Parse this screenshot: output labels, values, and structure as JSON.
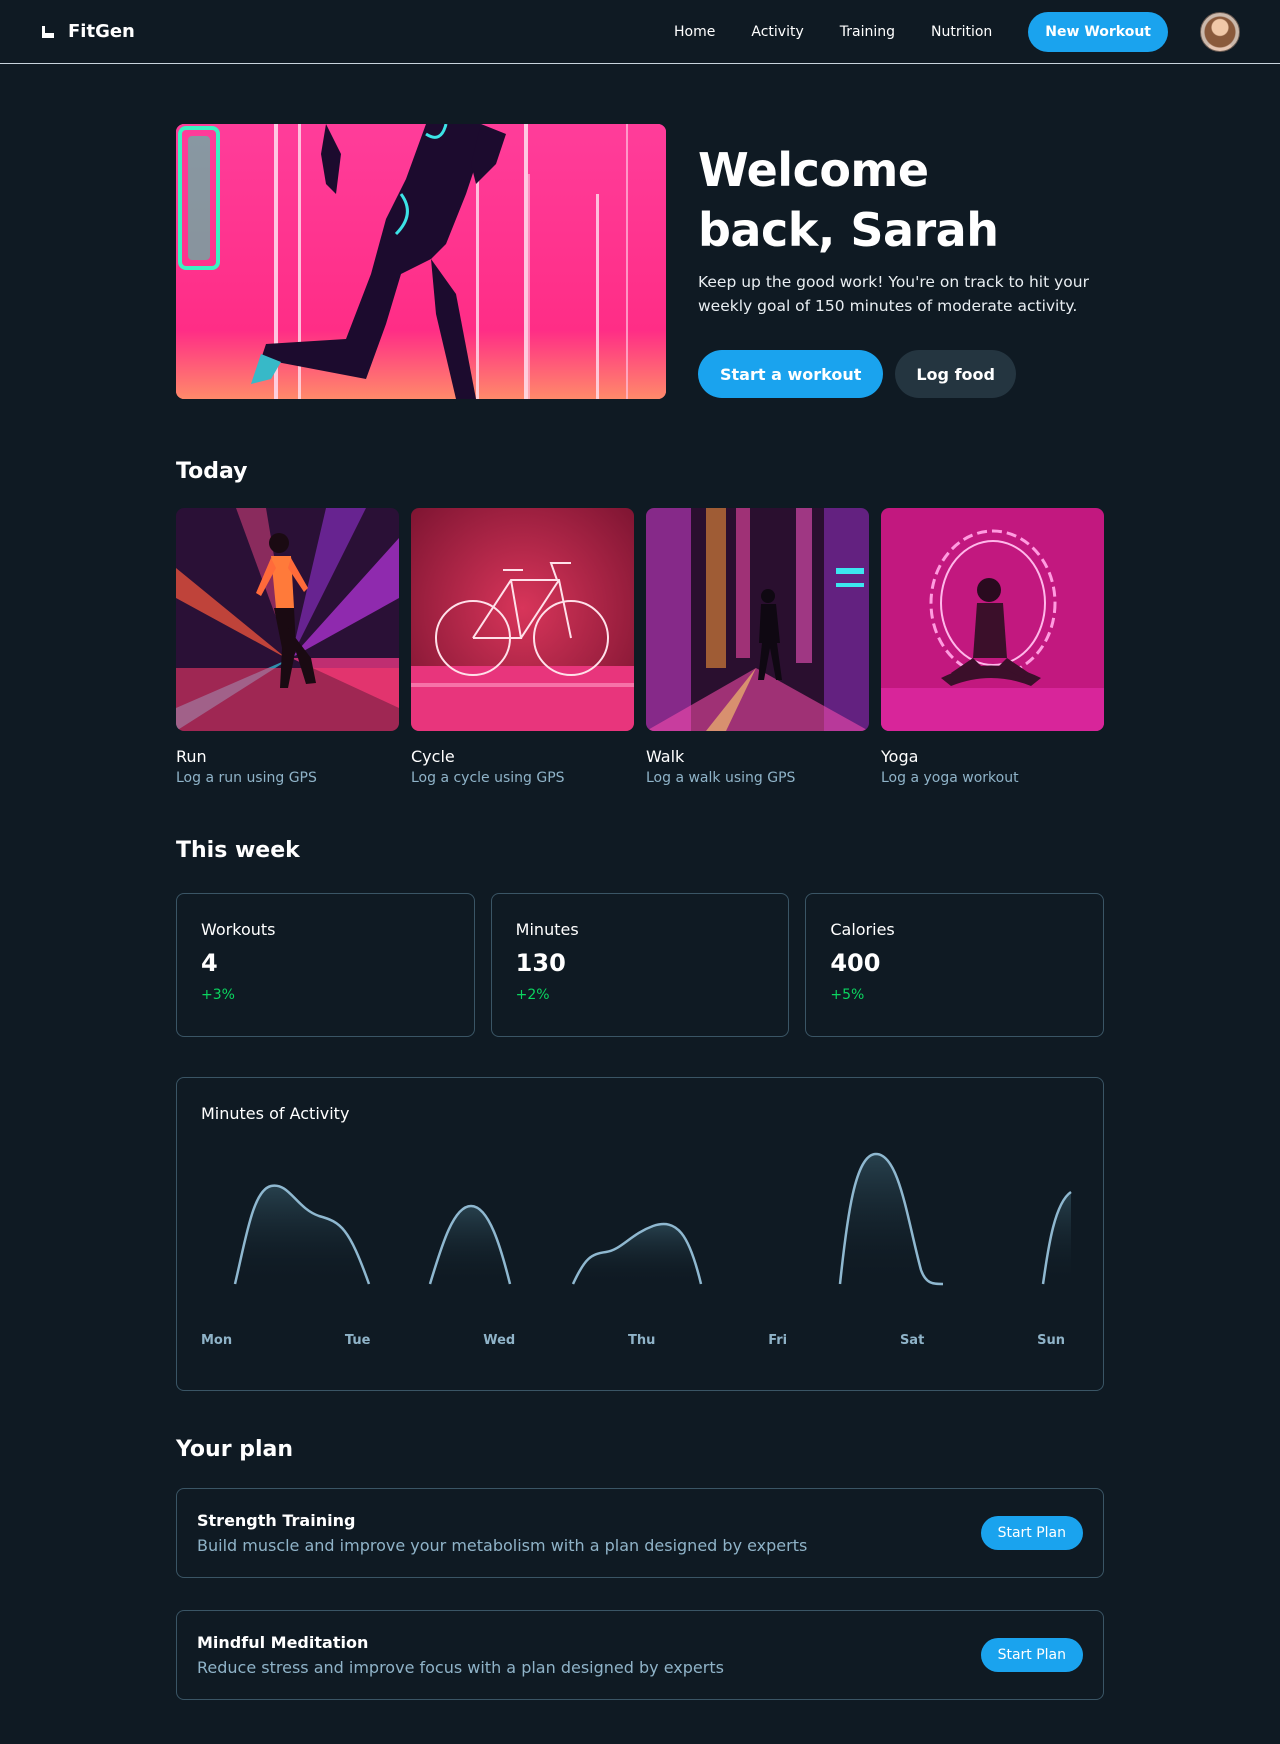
{
  "header": {
    "brand": "FitGen",
    "nav": [
      "Home",
      "Activity",
      "Training",
      "Nutrition"
    ],
    "new_workout": "New Workout"
  },
  "hero": {
    "title": "Welcome back, Sarah",
    "description": "Keep up the good work! You're on track to hit your weekly goal of 150 minutes of moderate activity.",
    "primary_button": "Start a workout",
    "secondary_button": "Log food"
  },
  "today": {
    "title": "Today",
    "activities": [
      {
        "name": "Run",
        "desc": "Log a run using GPS"
      },
      {
        "name": "Cycle",
        "desc": "Log a cycle using GPS"
      },
      {
        "name": "Walk",
        "desc": "Log a walk using GPS"
      },
      {
        "name": "Yoga",
        "desc": "Log a yoga workout"
      }
    ]
  },
  "week": {
    "title": "This week",
    "stats": [
      {
        "label": "Workouts",
        "value": "4",
        "change": "+3%"
      },
      {
        "label": "Minutes",
        "value": "130",
        "change": "+2%"
      },
      {
        "label": "Calories",
        "value": "400",
        "change": "+5%"
      }
    ]
  },
  "chart_data": {
    "type": "area",
    "title": "Minutes of Activity",
    "categories": [
      "Mon",
      "Tue",
      "Wed",
      "Thu",
      "Fri",
      "Sat",
      "Sun"
    ],
    "xlabel": "",
    "ylabel": "",
    "grid": false,
    "line_color": "#8fb8d0"
  },
  "plan": {
    "title": "Your plan",
    "items": [
      {
        "name": "Strength Training",
        "desc": "Build muscle and improve your metabolism with a plan designed by experts",
        "button": "Start Plan"
      },
      {
        "name": "Mindful Meditation",
        "desc": "Reduce stress and improve focus with a plan designed by experts",
        "button": "Start Plan"
      }
    ]
  },
  "colors": {
    "background": "#0f1a23",
    "accent": "#1aa3ee",
    "positive": "#0bd45f",
    "muted_text": "#8fb3c8"
  }
}
